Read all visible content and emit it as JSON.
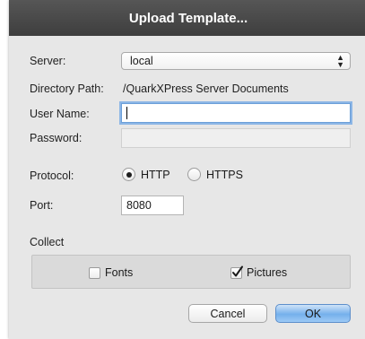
{
  "dialog": {
    "title": "Upload Template...",
    "server_label": "Server:",
    "server_value": "local",
    "directory_label": "Directory Path:",
    "directory_value": "/QuarkXPress Server Documents",
    "username_label": "User Name:",
    "username_value": "",
    "password_label": "Password:",
    "password_value": "",
    "protocol_label": "Protocol:",
    "protocol_options": [
      {
        "label": "HTTP",
        "selected": true
      },
      {
        "label": "HTTPS",
        "selected": false
      }
    ],
    "port_label": "Port:",
    "port_value": "8080",
    "collect_label": "Collect",
    "collect_options": [
      {
        "label": "Fonts",
        "checked": false
      },
      {
        "label": "Pictures",
        "checked": true
      }
    ],
    "cancel_label": "Cancel",
    "ok_label": "OK"
  },
  "colors": {
    "title_bar": "#4a4a4a",
    "dialog_bg": "#e7e7e7",
    "focus_ring": "#8cb6e6",
    "default_button": "#75b0ec"
  }
}
